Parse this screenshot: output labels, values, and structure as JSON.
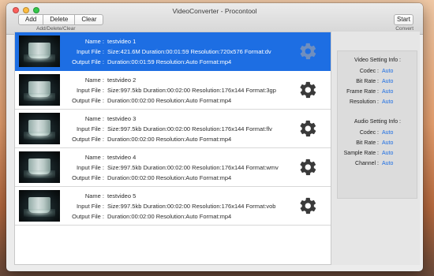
{
  "window": {
    "title": "VideoConverter - Procontool"
  },
  "toolbar": {
    "add_label": "Add",
    "delete_label": "Delete",
    "clear_label": "Clear",
    "group_caption": "Add/Delete/Clear",
    "start_label": "Start",
    "start_caption": "Convert"
  },
  "labels": {
    "name": "Name :",
    "input": "Input File :",
    "output": "Output File :"
  },
  "items": [
    {
      "name": "testvideo 1",
      "input": "Size:421.6M  Duration:00:01:59  Resolution:720x576  Format:dv",
      "output": "Duration:00:01:59  Resolution:Auto  Format:mp4"
    },
    {
      "name": "testvideo 2",
      "input": "Size:997.5kb  Duration:00:02:00  Resolution:176x144  Format:3gp",
      "output": "Duration:00:02:00  Resolution:Auto  Format:mp4"
    },
    {
      "name": "testvideo 3",
      "input": "Size:997.5kb  Duration:00:02:00  Resolution:176x144  Format:flv",
      "output": "Duration:00:02:00  Resolution:Auto  Format:mp4"
    },
    {
      "name": "testvideo 4",
      "input": "Size:997.5kb  Duration:00:02:00  Resolution:176x144  Format:wmv",
      "output": "Duration:00:02:00  Resolution:Auto  Format:mp4"
    },
    {
      "name": "testvideo 5",
      "input": "Size:997.5kb  Duration:00:02:00  Resolution:176x144  Format:vob",
      "output": "Duration:00:02:00  Resolution:Auto  Format:mp4"
    }
  ],
  "selected_index": 0,
  "video_settings": {
    "title": "Video Setting Info :",
    "rows": [
      {
        "label": "Codec :",
        "value": "Auto"
      },
      {
        "label": "Bit Rate :",
        "value": "Auto"
      },
      {
        "label": "Frame Rate :",
        "value": "Auto"
      },
      {
        "label": "Resolution :",
        "value": "Auto"
      }
    ]
  },
  "audio_settings": {
    "title": "Audio Setting Info :",
    "rows": [
      {
        "label": "Codec :",
        "value": "Auto"
      },
      {
        "label": "Bit Rate :",
        "value": "Auto"
      },
      {
        "label": "Sample Rate :",
        "value": "Auto"
      },
      {
        "label": "Channel :",
        "value": "Auto"
      }
    ]
  },
  "colors": {
    "accent": "#1d6ee3",
    "selected_row": "#1d6ee3"
  }
}
